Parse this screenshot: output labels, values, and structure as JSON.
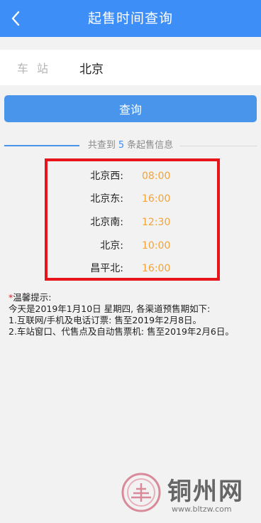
{
  "header": {
    "title": "起售时间查询",
    "back_icon": "chevron-left-icon"
  },
  "station": {
    "label": "车站",
    "value": "北京"
  },
  "query_button": {
    "label": "查询"
  },
  "summary": {
    "prefix": "共查到",
    "count": "5",
    "suffix": "条起售信息"
  },
  "results": [
    {
      "station": "北京西:",
      "time": "08:00"
    },
    {
      "station": "北京东:",
      "time": "16:00"
    },
    {
      "station": "北京南:",
      "time": "12:30"
    },
    {
      "station": "北京:",
      "time": "10:00"
    },
    {
      "station": "昌平北:",
      "time": "16:00"
    }
  ],
  "tips": {
    "star": "*",
    "title": "温馨提示:",
    "lines": [
      "今天是2019年1月10日 星期四, 各渠道预售期如下:",
      "1.互联网/手机及电话订票: 售至2019年2月8日。",
      "2.车站窗口、代售点及自动售票机: 售至2019年2月6日。"
    ]
  },
  "watermark": {
    "name": "铜州网",
    "url": "www.bltzw.com"
  },
  "colors": {
    "header": "#3e8ef7",
    "button": "#4a95ec",
    "time": "#f2a33a",
    "highlight_border": "#e8141b"
  }
}
